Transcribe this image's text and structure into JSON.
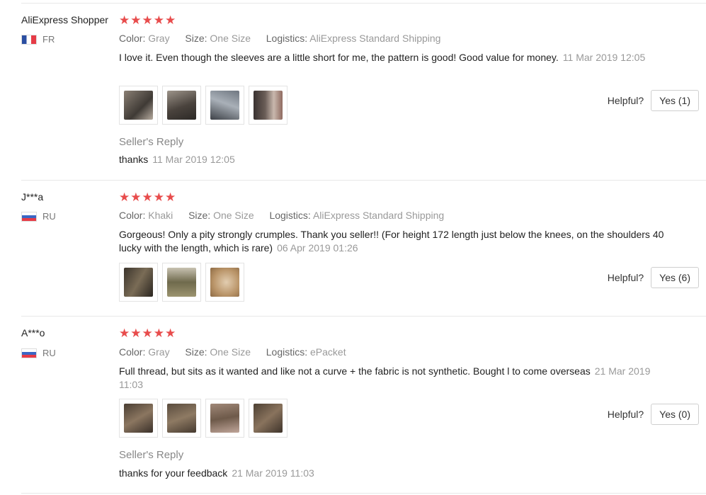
{
  "reviews": [
    {
      "user": "AliExpress Shopper",
      "country": "FR",
      "flag": "flag-fr",
      "stars": "★★★★★",
      "color_label": "Color:",
      "color_value": "Gray",
      "size_label": "Size:",
      "size_value": "One Size",
      "logistics_label": "Logistics:",
      "logistics_value": "AliExpress Standard Shipping",
      "text": "I love it. Even though the sleeves are a little short for me, the pattern is good! Good value for money.",
      "date": "11 Mar 2019 12:05",
      "photo_count": 4,
      "helpful_label": "Helpful?",
      "yes_label": "Yes (1)",
      "seller_reply_title": "Seller's Reply",
      "seller_reply_text": "thanks",
      "seller_reply_date": "11 Mar 2019 12:05"
    },
    {
      "user": "J***a",
      "country": "RU",
      "flag": "flag-ru",
      "stars": "★★★★★",
      "color_label": "Color:",
      "color_value": "Khaki",
      "size_label": "Size:",
      "size_value": "One Size",
      "logistics_label": "Logistics:",
      "logistics_value": "AliExpress Standard Shipping",
      "text": "Gorgeous! Only a pity strongly crumples. Thank you seller!! (For height 172 length just below the knees, on the shoulders 40 lucky with the length, which is rare)",
      "date": "06 Apr 2019 01:26",
      "photo_count": 3,
      "helpful_label": "Helpful?",
      "yes_label": "Yes (6)"
    },
    {
      "user": "A***o",
      "country": "RU",
      "flag": "flag-ru",
      "stars": "★★★★★",
      "color_label": "Color:",
      "color_value": "Gray",
      "size_label": "Size:",
      "size_value": "One Size",
      "logistics_label": "Logistics:",
      "logistics_value": "ePacket",
      "text": "Full thread, but sits as it wanted and like not a curve + the fabric is not synthetic. Bought l to come overseas",
      "date": "21 Mar 2019 11:03",
      "photo_count": 4,
      "helpful_label": "Helpful?",
      "yes_label": "Yes (0)",
      "seller_reply_title": "Seller's Reply",
      "seller_reply_text": "thanks for your feedback",
      "seller_reply_date": "21 Mar 2019 11:03"
    }
  ]
}
